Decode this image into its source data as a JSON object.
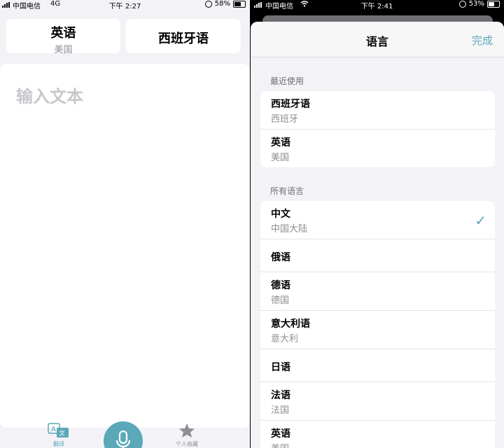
{
  "left": {
    "status": {
      "carrier": "中国电信",
      "network": "4G",
      "time": "下午 2:27",
      "battery": "58%"
    },
    "source_lang": {
      "name": "英语",
      "region": "美国"
    },
    "target_lang": {
      "name": "西班牙语"
    },
    "input_placeholder": "输入文本",
    "tabs": [
      {
        "label": "翻译",
        "icon": "translate-icon"
      },
      {
        "label": "个人收藏",
        "icon": "star-icon"
      }
    ],
    "accent": "#5ba8b8"
  },
  "right": {
    "status": {
      "carrier": "中国电信",
      "time": "下午 2:41",
      "battery": "53%"
    },
    "title": "语言",
    "done": "完成",
    "recent_header": "最近使用",
    "recent": [
      {
        "name": "西班牙语",
        "region": "西班牙"
      },
      {
        "name": "英语",
        "region": "美国"
      }
    ],
    "all_header": "所有语言",
    "all": [
      {
        "name": "中文",
        "region": "中国大陆",
        "selected": true
      },
      {
        "name": "俄语",
        "region": ""
      },
      {
        "name": "德语",
        "region": "德国"
      },
      {
        "name": "意大利语",
        "region": "意大利"
      },
      {
        "name": "日语",
        "region": ""
      },
      {
        "name": "法语",
        "region": "法国"
      },
      {
        "name": "英语",
        "region": "美国"
      }
    ]
  }
}
